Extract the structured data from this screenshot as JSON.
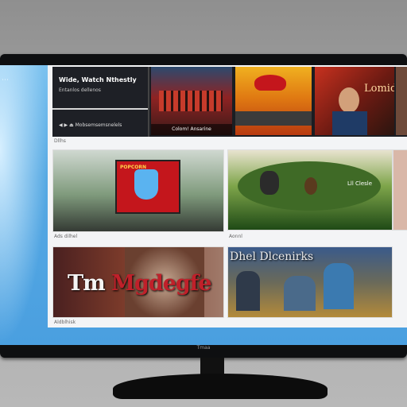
{
  "device": {
    "brand": "Tmaa"
  },
  "sidebar": {
    "icon": "menu-dots-icon",
    "glyph": "⋯"
  },
  "row1": {
    "info_card": {
      "title": "Wide, Watch Nthestly",
      "subtitle": "Entanlos dellenos",
      "controls": "◀ ▶ ⏏ Mobsemsemsnelels"
    },
    "thumbs": [
      {
        "caption": "Colom! Ansarine"
      },
      {
        "caption": ""
      },
      {
        "caption": "Lomid"
      },
      {
        "caption": ""
      }
    ]
  },
  "sections": [
    {
      "label": "Dllhs"
    },
    {
      "label": "Ads dilhel"
    },
    {
      "label": "Aonnl"
    },
    {
      "label": "Aldblhisk"
    }
  ],
  "cards": {
    "poster_text": "POPCORN",
    "overlay_texts": [
      "Dhel Dlcenirks",
      "Lll Clesle"
    ],
    "big_title": {
      "prefix": "Tm ",
      "word": "Mgdegfe"
    }
  },
  "colors": {
    "screen": "#4a9fe0",
    "panel": "#f3f4f6",
    "accent": "#c0202a"
  }
}
